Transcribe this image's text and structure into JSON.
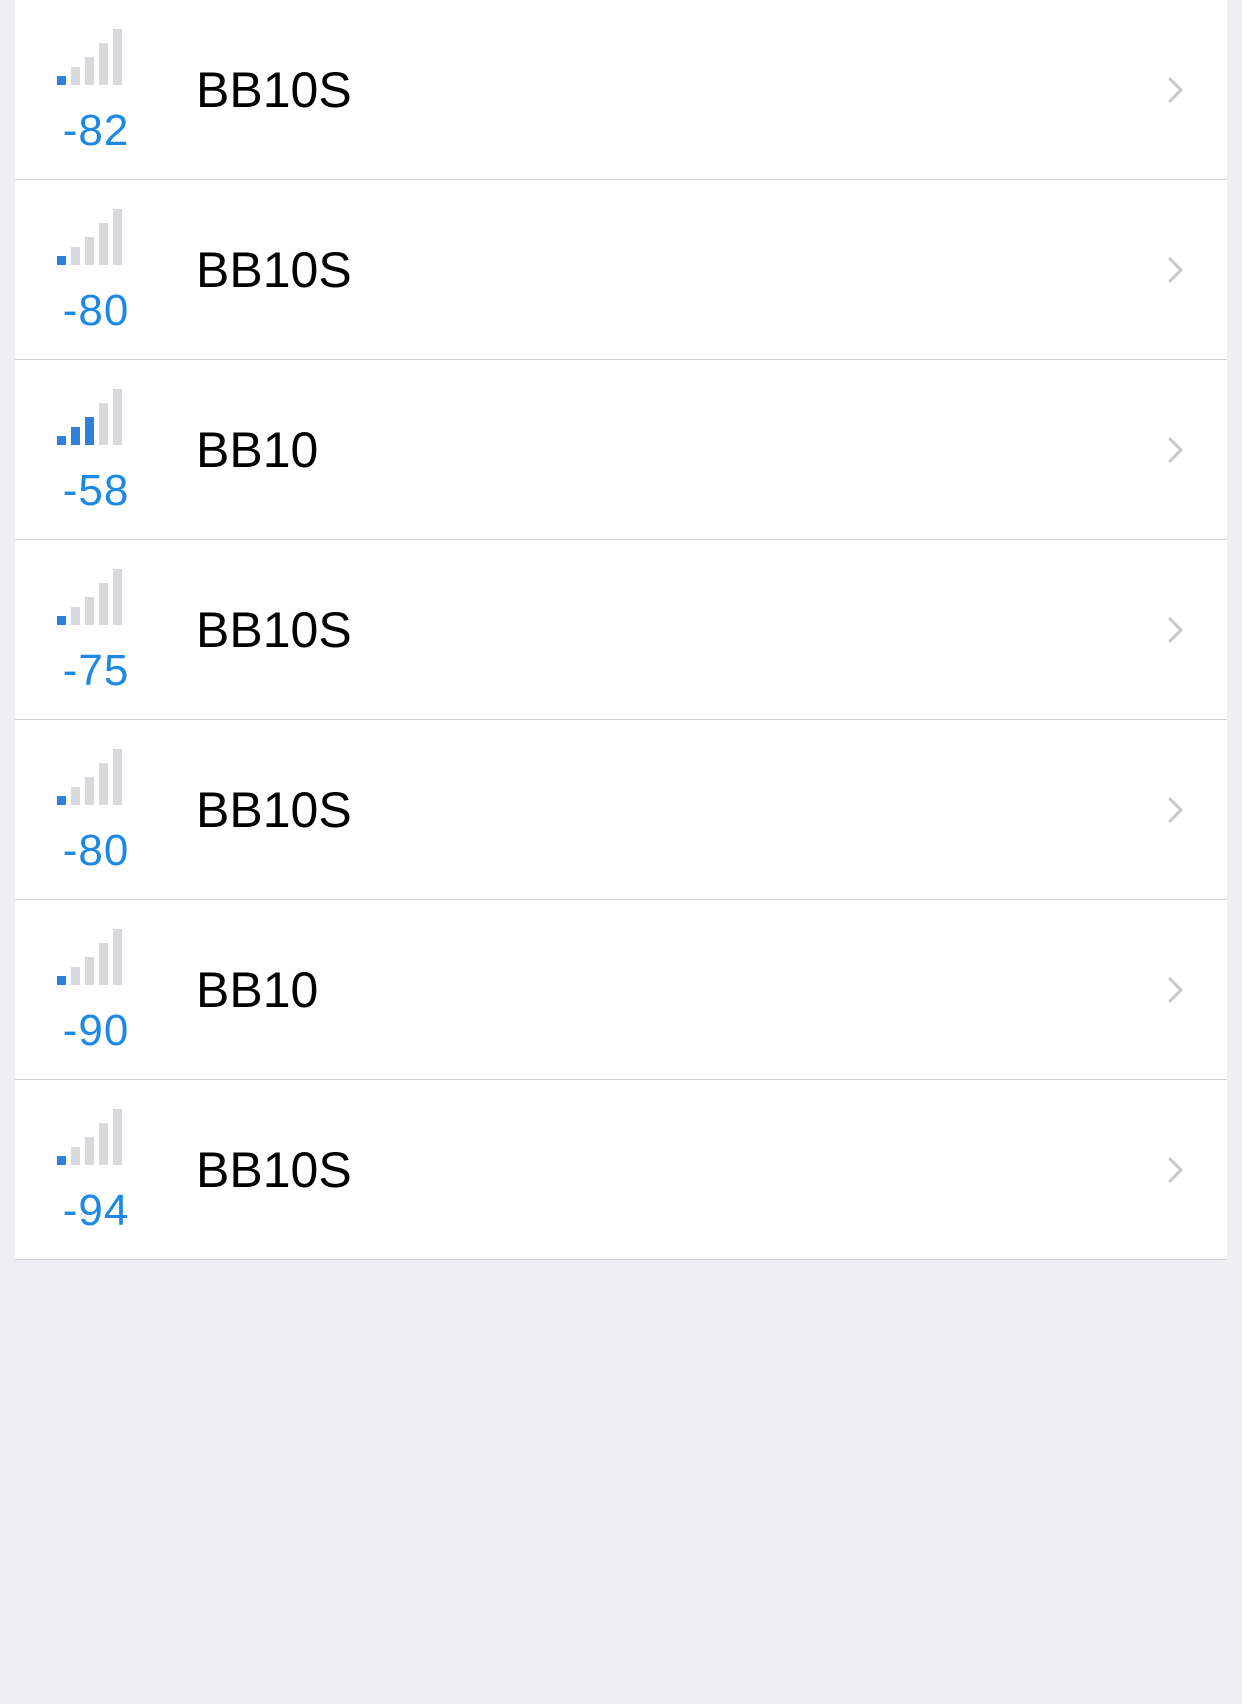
{
  "colors": {
    "accent": "#1E88E5",
    "bar_active": "#2F80D8",
    "bar_inactive": "#D9D9DD",
    "background": "#EEEEF3",
    "separator": "#D1D1D6",
    "chevron": "#C7C7CC"
  },
  "devices": [
    {
      "rssi": "-82",
      "name": "BB10S",
      "signal_level": 1,
      "signal_max": 5
    },
    {
      "rssi": "-80",
      "name": "BB10S",
      "signal_level": 1,
      "signal_max": 5
    },
    {
      "rssi": "-58",
      "name": "BB10",
      "signal_level": 3,
      "signal_max": 5
    },
    {
      "rssi": "-75",
      "name": "BB10S",
      "signal_level": 1,
      "signal_max": 5
    },
    {
      "rssi": "-80",
      "name": "BB10S",
      "signal_level": 1,
      "signal_max": 5
    },
    {
      "rssi": "-90",
      "name": "BB10",
      "signal_level": 1,
      "signal_max": 5
    },
    {
      "rssi": "-94",
      "name": "BB10S",
      "signal_level": 1,
      "signal_max": 5
    }
  ],
  "icons": {
    "signal": "signal-strength-icon",
    "disclosure": "chevron-right-icon"
  }
}
